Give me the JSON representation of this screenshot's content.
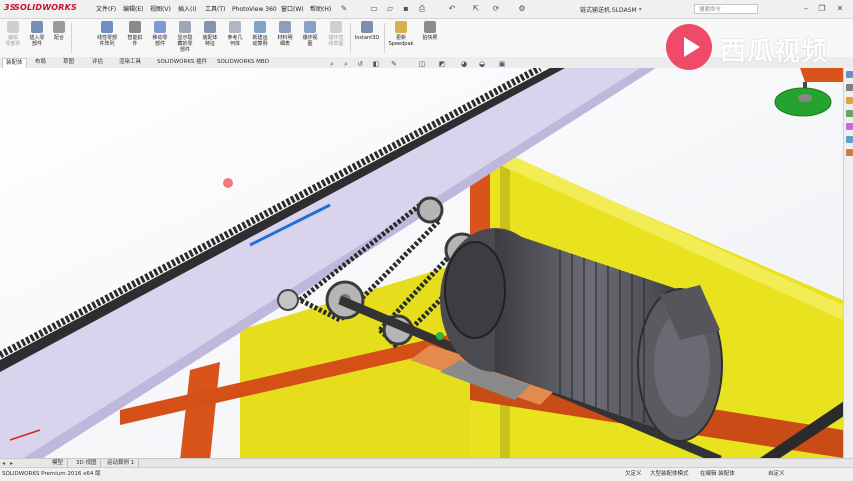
{
  "app": {
    "logo_text": "SOLIDWORKS",
    "logo_prefix": "3S",
    "document_title": "链式输送机.SLDASM *"
  },
  "menu": [
    "文件(F)",
    "编辑(E)",
    "视图(V)",
    "插入(I)",
    "工具(T)",
    "PhotoView 360",
    "窗口(W)",
    "帮助(H)"
  ],
  "search": {
    "placeholder": "搜索命令"
  },
  "ribbon": {
    "tools": [
      {
        "label": "编辑\n零部件",
        "icon": "edit-component-icon",
        "disabled": true
      },
      {
        "label": "插入零\n部件",
        "icon": "insert-component-icon",
        "disabled": false
      },
      {
        "label": "配合",
        "icon": "mate-icon",
        "disabled": false
      },
      {
        "label": "线性零部\n件阵列",
        "icon": "linear-pattern-icon",
        "disabled": false
      },
      {
        "label": "智能扣\n件",
        "icon": "smart-fasteners-icon",
        "disabled": false
      },
      {
        "label": "移动零\n部件",
        "icon": "move-component-icon",
        "disabled": false
      },
      {
        "label": "显示隐\n藏的零\n部件",
        "icon": "show-hidden-icon",
        "disabled": false
      },
      {
        "label": "装配体\n特征",
        "icon": "assembly-features-icon",
        "disabled": false
      },
      {
        "label": "参考几\n何体",
        "icon": "reference-geometry-icon",
        "disabled": false
      },
      {
        "label": "新建运\n动算例",
        "icon": "new-motion-study-icon",
        "disabled": false
      },
      {
        "label": "材料明\n细表",
        "icon": "bill-of-materials-icon",
        "disabled": false
      },
      {
        "label": "爆炸视\n图",
        "icon": "exploded-view-icon",
        "disabled": false
      },
      {
        "label": "爆炸直\n线草图",
        "icon": "explode-line-sketch-icon",
        "disabled": true
      },
      {
        "label": "Instant3D",
        "icon": "instant3d-icon",
        "disabled": false
      },
      {
        "label": "更新\nSpeedpak",
        "icon": "speedpak-icon",
        "disabled": false
      },
      {
        "label": "拍快照",
        "icon": "snapshot-icon",
        "disabled": false
      }
    ]
  },
  "tabs": [
    "装配体",
    "布局",
    "草图",
    "评估",
    "渲染工具",
    "SOLIDWORKS 插件",
    "SOLIDWORKS MBD"
  ],
  "active_tab": 0,
  "model_tabs": [
    "模型",
    "3D 视图",
    "运动算例 1"
  ],
  "status": {
    "left": "SOLIDWORKS Premium 2016 x64 版",
    "state": "欠定义",
    "mode": "大型装配体模式",
    "editing": "在编辑 装配体",
    "custom": "自定义"
  },
  "watermark": {
    "text": "西瓜视频"
  },
  "colors": {
    "frame_yellow": "#e9e21f",
    "frame_orange": "#d9541b",
    "motor_gray": "#5a5a60",
    "chain_dark": "#2b2b2b",
    "rail_lavender": "#d9d3ee",
    "accent_red": "#c8102e",
    "watermark_pink": "#ef4a68"
  }
}
